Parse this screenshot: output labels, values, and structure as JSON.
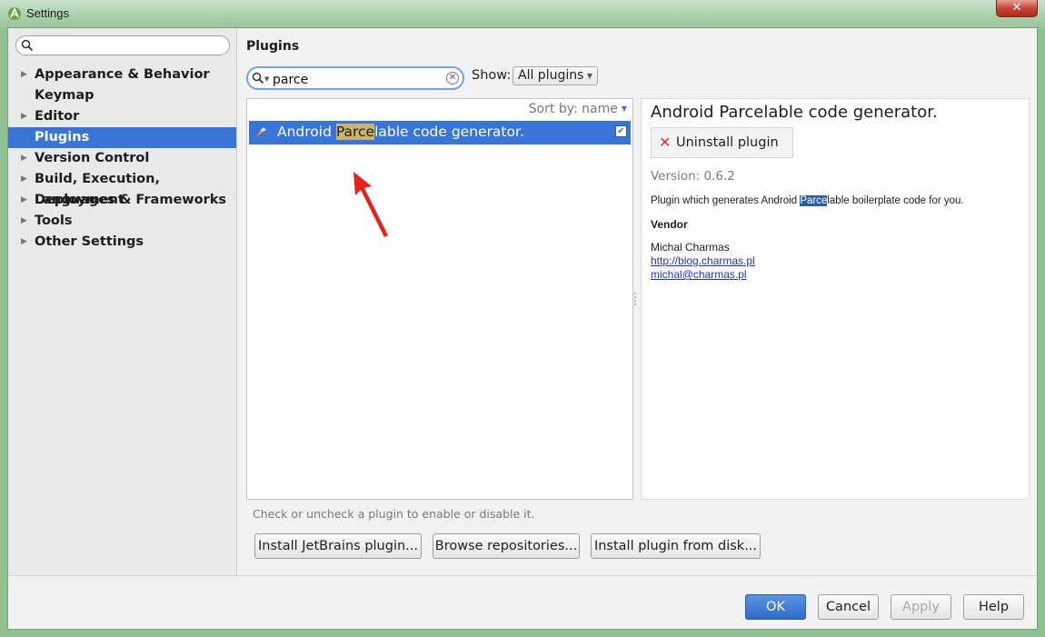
{
  "window": {
    "title": "Settings",
    "close_label": "✕"
  },
  "sidebar": {
    "search_placeholder": "",
    "items": [
      {
        "label": "Appearance & Behavior",
        "expandable": true,
        "selected": false
      },
      {
        "label": "Keymap",
        "expandable": false,
        "selected": false
      },
      {
        "label": "Editor",
        "expandable": true,
        "selected": false
      },
      {
        "label": "Plugins",
        "expandable": false,
        "selected": true
      },
      {
        "label": "Version Control",
        "expandable": true,
        "selected": false
      },
      {
        "label": "Build, Execution, Deployment",
        "expandable": true,
        "selected": false
      },
      {
        "label": "Languages & Frameworks",
        "expandable": true,
        "selected": false
      },
      {
        "label": "Tools",
        "expandable": true,
        "selected": false
      },
      {
        "label": "Other Settings",
        "expandable": true,
        "selected": false
      }
    ]
  },
  "main": {
    "title": "Plugins",
    "search_value": "parce",
    "show_label": "Show:",
    "show_value": "All plugins",
    "sort_label": "Sort by: name",
    "plugins": [
      {
        "name_before": "Android ",
        "name_match": "Parce",
        "name_after": "lable code generator.",
        "enabled": true,
        "selected": true
      }
    ],
    "hint": "Check or uncheck a plugin to enable or disable it.",
    "buttons": {
      "install_jetbrains": "Install JetBrains plugin...",
      "browse": "Browse repositories...",
      "install_disk": "Install plugin from disk..."
    }
  },
  "details": {
    "title": "Android Parcelable code generator.",
    "uninstall_label": "Uninstall plugin",
    "version": "Version: 0.6.2",
    "desc_before": "Plugin which generates Android ",
    "desc_match": "Parce",
    "desc_after": "lable boilerplate code for you.",
    "vendor_heading": "Vendor",
    "vendor_name": "Michal Charmas",
    "vendor_url": "http://blog.charmas.pl",
    "vendor_email": "michal@charmas.pl"
  },
  "footer": {
    "ok": "OK",
    "cancel": "Cancel",
    "apply": "Apply",
    "help": "Help"
  },
  "colors": {
    "selection": "#3875d6",
    "match_highlight": "#c9b36d",
    "annotation_arrow": "#e8201a"
  }
}
